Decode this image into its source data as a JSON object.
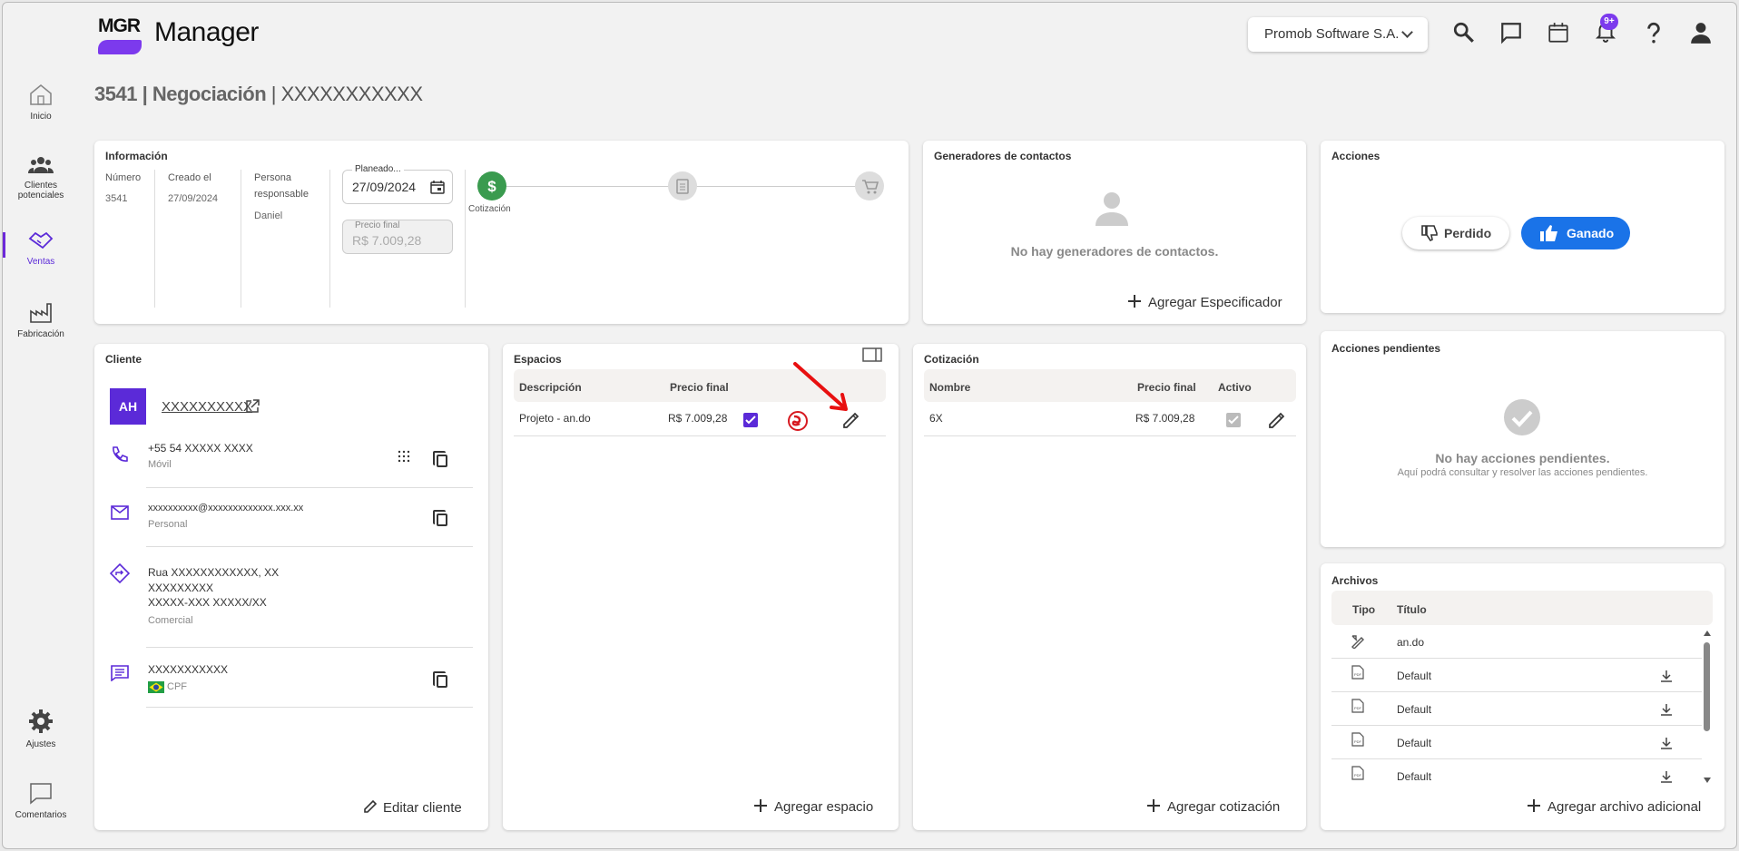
{
  "app": {
    "logo_text": "MGR",
    "name": "Manager",
    "company": "Promob Software S.A.",
    "notifications": "9+"
  },
  "sidebar": [
    {
      "label": "Inicio",
      "icon": "home-icon"
    },
    {
      "label": "Clientes potenciales",
      "icon": "people-icon"
    },
    {
      "label": "Ventas",
      "icon": "handshake-icon"
    },
    {
      "label": "Fabricación",
      "icon": "factory-icon"
    },
    {
      "label": "Ajustes",
      "icon": "gear-icon"
    },
    {
      "label": "Comentarios",
      "icon": "comment-icon"
    }
  ],
  "page": {
    "number": "3541",
    "stage": "Negociación",
    "name": "XXXXXXXXXXX"
  },
  "info": {
    "title": "Información",
    "numero_label": "Número",
    "numero": "3541",
    "creado_label": "Creado el",
    "creado": "27/09/2024",
    "persona_label": "Persona responsable",
    "persona": "Daniel",
    "planeado_label": "Planeado...",
    "planeado": "27/09/2024",
    "precio_label": "Precio final",
    "precio": "R$ 7.009,28",
    "steps": [
      {
        "label": "Cotización",
        "icon": "dollar-icon"
      },
      {
        "label": "",
        "icon": "clipboard-icon"
      },
      {
        "label": "",
        "icon": "cart-icon"
      }
    ]
  },
  "generadores": {
    "title": "Generadores de contactos",
    "empty": "No hay generadores de contactos.",
    "add": "Agregar Especificador"
  },
  "acciones": {
    "title": "Acciones",
    "lost": "Perdido",
    "won": "Ganado"
  },
  "pendientes": {
    "title": "Acciones pendientes",
    "empty": "No hay acciones pendientes.",
    "hint": "Aquí podrá consultar y resolver las acciones pendientes."
  },
  "cliente": {
    "title": "Cliente",
    "initials": "AH",
    "name": "XXXXXXXXXX",
    "phone": "+55 54 XXXXX XXXX",
    "phone_type": "Móvil",
    "email": "xxxxxxxxxx@xxxxxxxxxxxxx.xxx.xx",
    "email_type": "Personal",
    "address1": "Rua XXXXXXXXXXXX, XX",
    "address2": "XXXXXXXXX",
    "address3": "XXXXX-XXX XXXXX/XX",
    "address_type": "Comercial",
    "doc": "XXXXXXXXXXX",
    "doc_type": "CPF",
    "edit": "Editar cliente"
  },
  "espacios": {
    "title": "Espacios",
    "columns": [
      "Descripción",
      "Precio final"
    ],
    "rows": [
      {
        "desc": "Projeto - an.do",
        "price": "R$ 7.009,28"
      }
    ],
    "add": "Agregar espacio"
  },
  "cotizacion": {
    "title": "Cotización",
    "columns": [
      "Nombre",
      "Precio final",
      "Activo"
    ],
    "rows": [
      {
        "name": "6X",
        "price": "R$ 7.009,28"
      }
    ],
    "add": "Agregar cotización"
  },
  "archivos": {
    "title": "Archivos",
    "columns": [
      "Tipo",
      "Título"
    ],
    "rows": [
      {
        "title": "an.do",
        "icon": "design-icon"
      },
      {
        "title": "Default",
        "icon": "pdf-icon"
      },
      {
        "title": "Default",
        "icon": "pdf-icon"
      },
      {
        "title": "Default",
        "icon": "pdf-icon"
      },
      {
        "title": "Default",
        "icon": "pdf-icon"
      }
    ],
    "add": "Agregar archivo adicional"
  },
  "colors": {
    "accent": "#7c3aed",
    "won": "#1a73e8",
    "success": "#3a9b4f",
    "alert": "#d71920"
  }
}
